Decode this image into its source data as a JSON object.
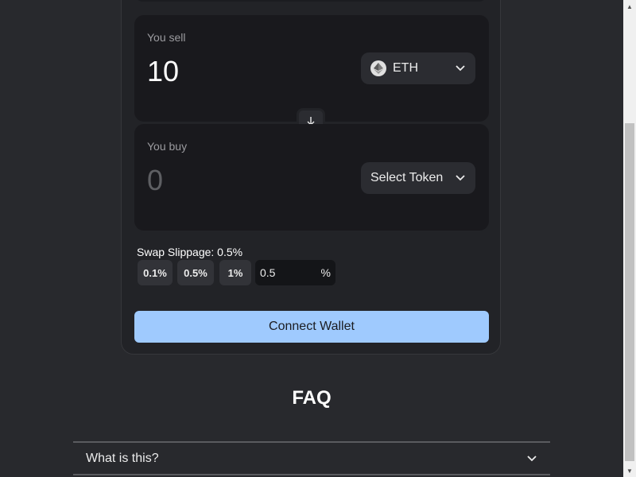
{
  "swap": {
    "sell": {
      "label": "You sell",
      "amount": "10",
      "token": "ETH",
      "token_icon": "ethereum-icon"
    },
    "buy": {
      "label": "You buy",
      "amount_placeholder": "0",
      "token_button": "Select Token"
    },
    "switch_icon": "arrow-down-icon"
  },
  "slippage": {
    "label": "Swap Slippage: 0.5%",
    "options": [
      "0.1%",
      "0.5%",
      "1%"
    ],
    "custom_value": "0.5",
    "unit": "%"
  },
  "connect_button": "Connect Wallet",
  "faq": {
    "title": "FAQ",
    "items": [
      {
        "question": "What is this?"
      }
    ]
  },
  "colors": {
    "background": "#28292d",
    "card": "#222327",
    "panel": "#19191d",
    "accent": "#9fcafe"
  }
}
